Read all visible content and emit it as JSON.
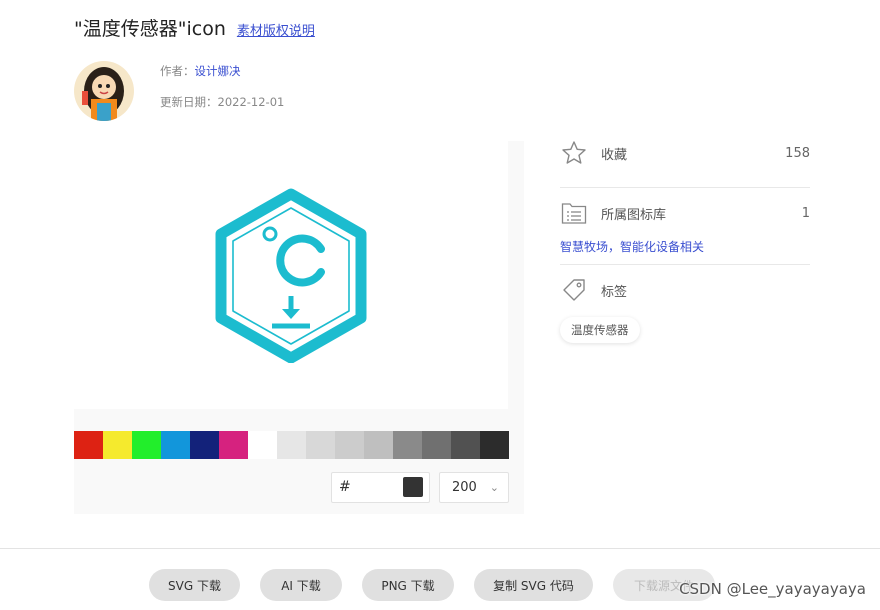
{
  "header": {
    "title": "\"温度传感器\"icon",
    "copyright_link": "素材版权说明"
  },
  "meta": {
    "author_label": "作者：",
    "author_name": "设计娜决",
    "date_label": "更新日期：",
    "date_value": "2022-12-01"
  },
  "icon": {
    "name": "temperature-sensor-icon",
    "color": "#1cbccf"
  },
  "palette": [
    "#dd2213",
    "#f5ea2d",
    "#22ee2b",
    "#1296db",
    "#13227a",
    "#d6227f",
    "#ffffff",
    "#e6e6e6",
    "#d8d8d8",
    "#cccccc",
    "#bfbfbf",
    "#8a8a8a",
    "#707070",
    "#515151",
    "#2c2c2c"
  ],
  "color_input": {
    "hash": "#",
    "value": "",
    "chip_color": "#333333"
  },
  "size_select": {
    "value": "200"
  },
  "sidebar": {
    "favorite_label": "收藏",
    "favorite_count": "158",
    "library_label": "所属图标库",
    "library_count": "1",
    "library_link": "智慧牧场，智能化设备相关",
    "tags_label": "标签",
    "tags": [
      "温度传感器"
    ]
  },
  "actions": {
    "svg_download": "SVG 下载",
    "ai_download": "AI 下载",
    "png_download": "PNG 下载",
    "copy_svg": "复制 SVG 代码",
    "download_source": "下载源文件"
  },
  "watermark": "CSDN @Lee_yayayayaya"
}
